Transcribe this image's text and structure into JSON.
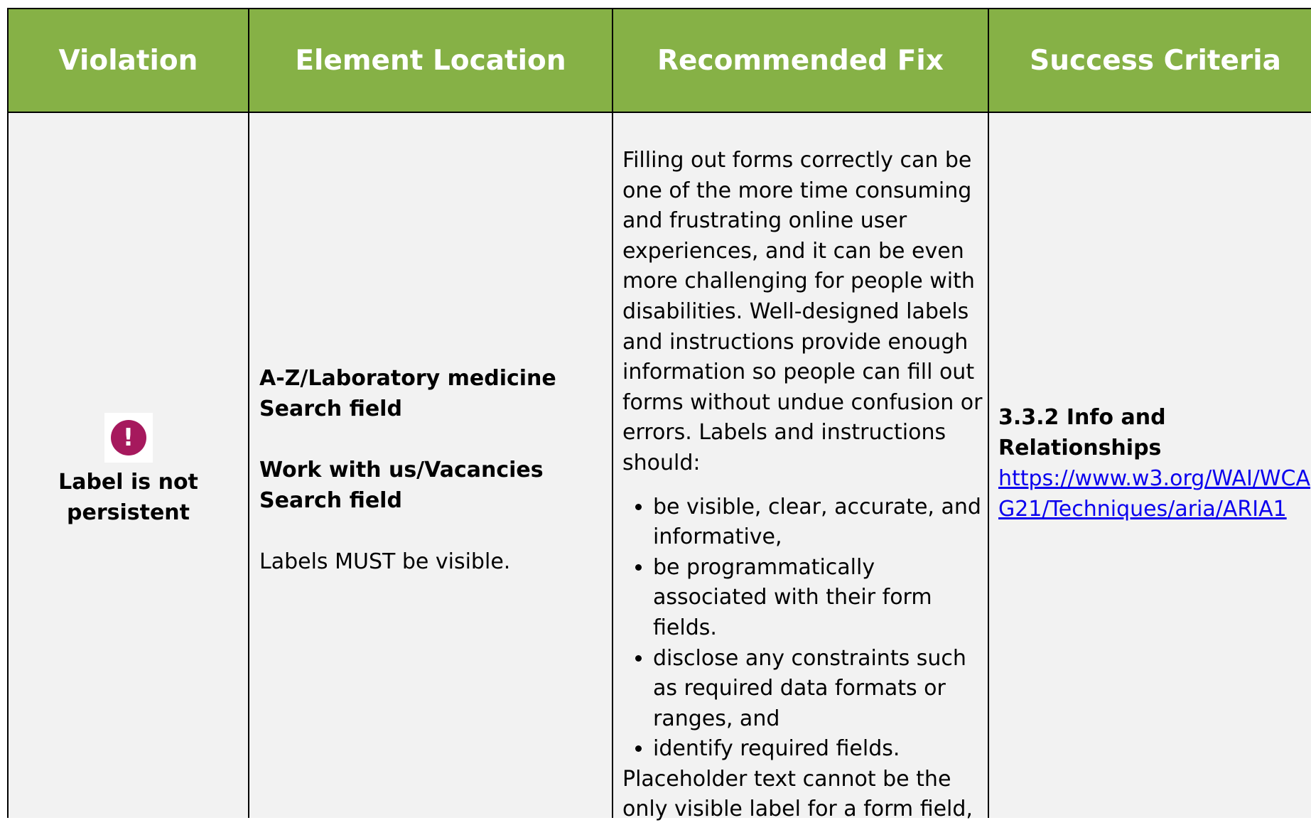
{
  "headers": [
    "Violation",
    "Element Location",
    "Recommended Fix",
    "Success Criteria"
  ],
  "row": {
    "violation": {
      "icon": "exclamation-icon",
      "icon_glyph": "!",
      "icon_color": "#a6195d",
      "label": "Label is not persistent"
    },
    "location": {
      "item1": "A-Z/Laboratory medicine Search field",
      "item2": "Work with us/Vacancies Search field",
      "note": "Labels MUST be visible."
    },
    "fix": {
      "intro": "Filling out forms correctly can be one of the more time consuming and frustrating online user experiences, and it can be even more challenging for people with disabilities. Well-designed labels and instructions provide enough information so people can fill out forms without undue confusion or errors. Labels and instructions should:",
      "bullets": [
        "be visible, clear, accurate, and informative,",
        "be programmatically associated with their form fields.",
        "disclose any constraints such as required data formats or ranges, and",
        "identify required fields."
      ],
      "outro": "Placeholder text cannot be the only visible label for a form field,"
    },
    "criteria": {
      "title": "3.3.2 Info and Relationships",
      "link": "https://www.w3.org/WAI/WCAG21/Techniques/aria/ARIA1"
    }
  },
  "colors": {
    "header_bg": "#86b146",
    "cell_bg": "#f2f2f2",
    "link": "#0b00ee"
  }
}
